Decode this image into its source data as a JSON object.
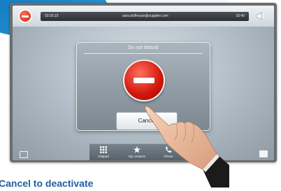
{
  "status_bar": {
    "left_text": "03.03.15",
    "center_text": "sara.dollhouse@supplier.com",
    "right_text": "15:40"
  },
  "dialog": {
    "title": "Do not disturb",
    "cancel_label": "Cancel"
  },
  "dock": {
    "items": [
      {
        "label": "Dialpad",
        "icon": "dialpad-icon"
      },
      {
        "label": "My contacts",
        "icon": "star-icon"
      },
      {
        "label": "Phone",
        "icon": "phone-icon"
      }
    ]
  },
  "caption": "Cancel to deactivate",
  "colors": {
    "brand_blue": "#1f5f9f",
    "dnd_red": "#d1160a"
  }
}
